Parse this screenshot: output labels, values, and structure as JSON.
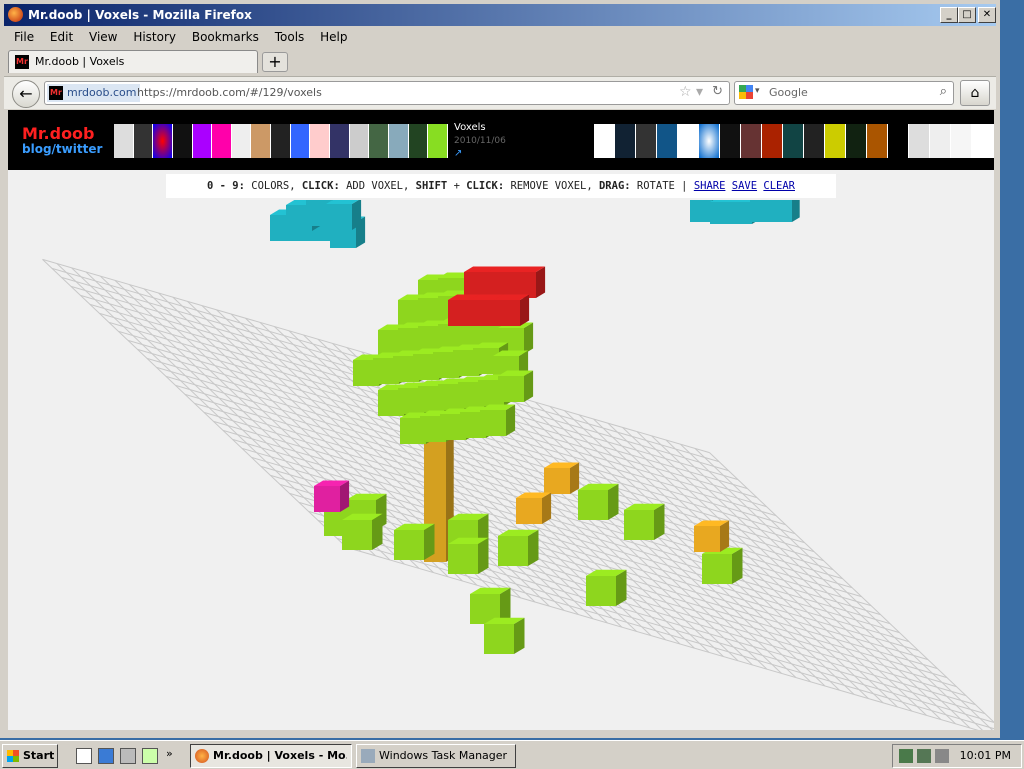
{
  "window": {
    "title": "Mr.doob | Voxels - Mozilla Firefox",
    "controls": {
      "minimize": "_",
      "maximize": "□",
      "close": "✕"
    }
  },
  "menu": [
    "File",
    "Edit",
    "View",
    "History",
    "Bookmarks",
    "Tools",
    "Help"
  ],
  "tab": {
    "label": "Mr.doob | Voxels",
    "favicon": "Mr"
  },
  "nav": {
    "site_label": "mrdoob.com",
    "url": "https://mrdoob.com/#/129/voxels",
    "search_placeholder": "Google"
  },
  "page": {
    "logo_line1": "Mr.doob",
    "logo_line2": "blog/twitter",
    "project_title": "Voxels",
    "project_date": "2010/11/06",
    "project_link_icon": "↗",
    "instructions": {
      "k1": "0 - 9:",
      "t1": " COLORS, ",
      "k2": "CLICK:",
      "t2": " ADD VOXEL, ",
      "k3": "SHIFT",
      "t3": " + ",
      "k4": "CLICK:",
      "t4": " REMOVE VOXEL, ",
      "k5": "DRAG:",
      "t5": " ROTATE | ",
      "share": "SHARE",
      "save": "SAVE",
      "clear": "CLEAR"
    }
  },
  "taskbar": {
    "start": "Start",
    "more": "»",
    "tasks": [
      {
        "label": "Mr.doob | Voxels - Mo..."
      },
      {
        "label": "Windows Task Manager"
      }
    ],
    "clock": "10:01 PM"
  },
  "colors": {
    "green": "#8ed61e",
    "brown": "#d4a020",
    "red": "#d42020",
    "cyan": "#20b0c0",
    "magenta": "#e020a0",
    "orange": "#e8a820"
  }
}
